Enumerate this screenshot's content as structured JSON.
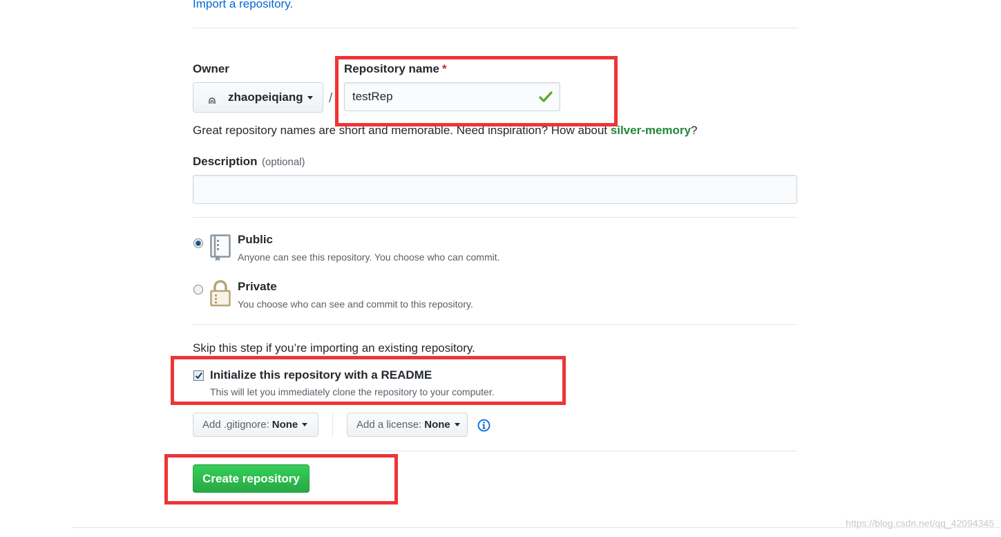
{
  "import_link": "Import a repository.",
  "owner": {
    "label": "Owner",
    "value": "zhaopeiqiang",
    "separator": "/"
  },
  "repo_name": {
    "label": "Repository name",
    "required_mark": "*",
    "value": "testRep",
    "valid_icon": "check-icon"
  },
  "suggestion": {
    "text": "Great repository names are short and memorable. Need inspiration? How about ",
    "name": "silver-memory",
    "suffix": "?"
  },
  "description": {
    "label": "Description",
    "optional": "(optional)",
    "value": "",
    "placeholder": ""
  },
  "visibility": {
    "public": {
      "title": "Public",
      "note": "Anyone can see this repository. You choose who can commit.",
      "icon": "repo-book-icon",
      "selected": true
    },
    "private": {
      "title": "Private",
      "note": "You choose who can see and commit to this repository.",
      "icon": "lock-icon",
      "selected": false
    }
  },
  "init": {
    "skip_text": "Skip this step if you’re importing an existing repository.",
    "readme_label": "Initialize this repository with a README",
    "readme_note": "This will let you immediately clone the repository to your computer.",
    "readme_checked": true
  },
  "gitignore": {
    "label": "Add .gitignore:",
    "value": "None"
  },
  "license": {
    "label": "Add a license:",
    "value": "None"
  },
  "info_icon": "info-icon",
  "create_button": "Create repository",
  "watermark": "https://blog.csdn.net/qq_42094345",
  "colors": {
    "link": "#0366d6",
    "suggestion": "#22863a",
    "annotation_red": "#ee3437",
    "create_green": "#2cbe4e",
    "check_green": "#28a745"
  }
}
